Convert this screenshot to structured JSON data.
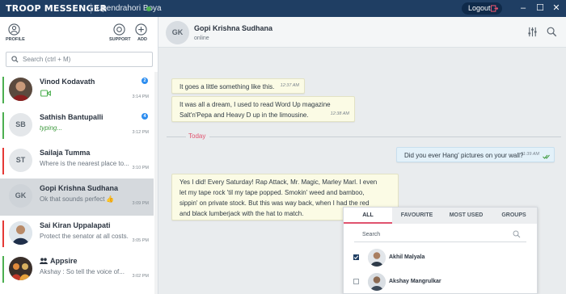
{
  "titlebar": {
    "brand": "TROOP MESSENGER",
    "user_name": "Upendrahori Boya",
    "logout_label": "Logout",
    "minimize": "–",
    "maximize": "☐",
    "close": "✕"
  },
  "sidebar": {
    "profile_label": "PROFILE",
    "support_label": "SUPPORT",
    "add_label": "ADD",
    "search_placeholder": "Search (ctrl + M)",
    "contacts": [
      {
        "name": "Vinod Kodavath",
        "message": "",
        "time": "3:14 PM",
        "badge": "2",
        "initials": "",
        "bar_color": "#4caf50"
      },
      {
        "name": "Sathish Bantupalli",
        "message": "typing...",
        "time": "3:12 PM",
        "badge": "4",
        "initials": "SB",
        "bar_color": "#4caf50"
      },
      {
        "name": "Sailaja Tumma",
        "message": "Where is the nearest place to...",
        "time": "3:10 PM",
        "badge": "",
        "initials": "ST",
        "bar_color": "#e53935"
      },
      {
        "name": "Gopi Krishna Sudhana",
        "message": "Ok that sounds perfect",
        "time": "3:09 PM",
        "badge": "",
        "initials": "GK",
        "bar_color": ""
      },
      {
        "name": "Sai Kiran Uppalapati",
        "message": "Protect the senator at all costs.",
        "time": "3:05 PM",
        "badge": "",
        "initials": "",
        "bar_color": "#e53935"
      },
      {
        "name": "Appsire",
        "message": "Akshay : So tell the voice of...",
        "time": "3:02 PM",
        "badge": "",
        "initials": "",
        "bar_color": "#4caf50"
      }
    ]
  },
  "chat": {
    "initials": "GK",
    "name": "Gopi Krishna Sudhana",
    "status": "online",
    "messages": [
      {
        "text": "It goes a little something like this.",
        "time": "12:37 AM",
        "direction": "in"
      },
      {
        "line1": "It was all a dream, I used to read Word Up magazine",
        "line2": "Salt'n'Pepa and Heavy D up in the limousine.",
        "time": "12:38 AM",
        "direction": "in"
      },
      {
        "text": "Did you ever Hang' pictures on your wall?",
        "time": "11:39 AM",
        "direction": "out"
      },
      {
        "line1": "Yes I did! Every Saturday! Rap Attack, Mr. Magic, Marley Marl. I even",
        "line2": "let my tape rock 'til my tape popped. Smokin' weed and bamboo,",
        "line3": "sippin' on private stock.  But this was way back, when I had the red",
        "line4": "and black lumberjack with the hat to match.",
        "direction": "in"
      }
    ],
    "separator_label": "Today"
  },
  "popup": {
    "tabs": [
      "ALL",
      "FAVOURITE",
      "MOST USED",
      "GROUPS"
    ],
    "search_placeholder": "Search",
    "members": [
      {
        "name": "Akhil Malyala",
        "checked": true
      },
      {
        "name": "Akshay Mangrulkar",
        "checked": false
      }
    ]
  },
  "colors": {
    "titlebar": "#1f3e63",
    "accent_red": "#e0526e",
    "online": "#4caf50",
    "badge": "#2c8df0"
  }
}
